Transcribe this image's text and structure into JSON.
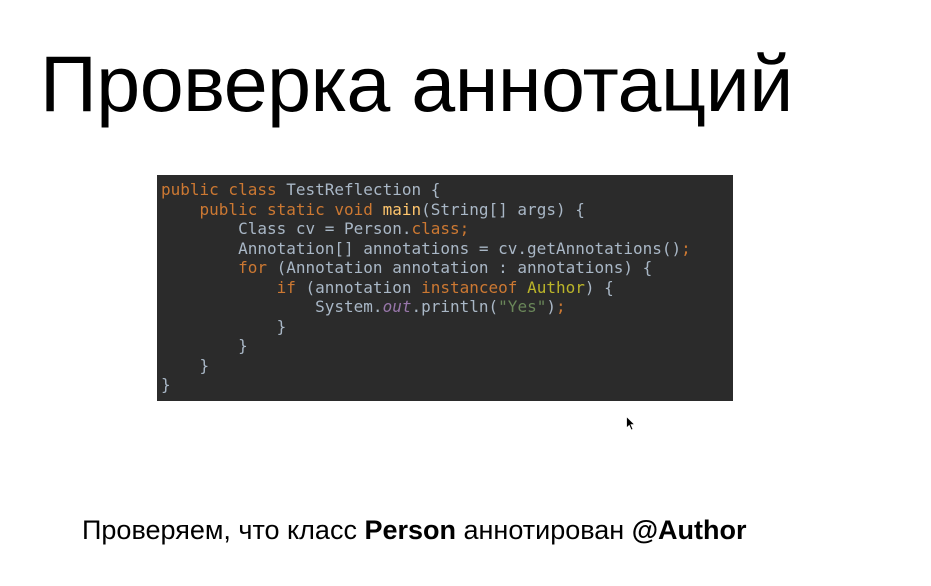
{
  "slide": {
    "title": "Проверка аннотаций",
    "caption": {
      "part1": "Проверяем, что класс ",
      "class_name": "Person",
      "part2": " аннотирован ",
      "annotation": "@Author"
    }
  },
  "code": {
    "lines": [
      [
        {
          "t": "public class ",
          "c": "kw"
        },
        {
          "t": "TestReflection {",
          "c": "plain"
        }
      ],
      [
        {
          "t": "    ",
          "c": "plain"
        },
        {
          "t": "public static void ",
          "c": "kw"
        },
        {
          "t": "main",
          "c": "fn"
        },
        {
          "t": "(String[] args) {",
          "c": "plain"
        }
      ],
      [
        {
          "t": "        Class cv = Person.",
          "c": "plain"
        },
        {
          "t": "class",
          "c": "kw"
        },
        {
          "t": ";",
          "c": "kw"
        }
      ],
      [
        {
          "t": "        Annotation[] annotations = cv.getAnnotations()",
          "c": "plain"
        },
        {
          "t": ";",
          "c": "kw"
        }
      ],
      [
        {
          "t": "        ",
          "c": "plain"
        },
        {
          "t": "for ",
          "c": "kw"
        },
        {
          "t": "(Annotation annotation : annotations) {",
          "c": "plain"
        }
      ],
      [
        {
          "t": "            ",
          "c": "plain"
        },
        {
          "t": "if ",
          "c": "kw"
        },
        {
          "t": "(annotation ",
          "c": "plain"
        },
        {
          "t": "instanceof ",
          "c": "kw"
        },
        {
          "t": "Author",
          "c": "ann"
        },
        {
          "t": ") {",
          "c": "plain"
        }
      ],
      [
        {
          "t": "                System.",
          "c": "plain"
        },
        {
          "t": "out",
          "c": "field"
        },
        {
          "t": ".println(",
          "c": "plain"
        },
        {
          "t": "\"Yes\"",
          "c": "str"
        },
        {
          "t": ")",
          "c": "plain"
        },
        {
          "t": ";",
          "c": "kw"
        }
      ],
      [
        {
          "t": "            }",
          "c": "plain"
        }
      ],
      [
        {
          "t": "        }",
          "c": "plain"
        }
      ],
      [
        {
          "t": "    }",
          "c": "plain"
        }
      ],
      [
        {
          "t": "}",
          "c": "plain"
        }
      ]
    ]
  },
  "colors": {
    "code_background": "#2b2b2b",
    "keyword": "#cc7832",
    "plain": "#a9b7c6",
    "method": "#ffc66d",
    "annotation_class": "#bbb529",
    "static_field": "#9876aa",
    "string": "#6a8759"
  },
  "icons": {
    "pointer": "mouse-pointer-icon"
  }
}
